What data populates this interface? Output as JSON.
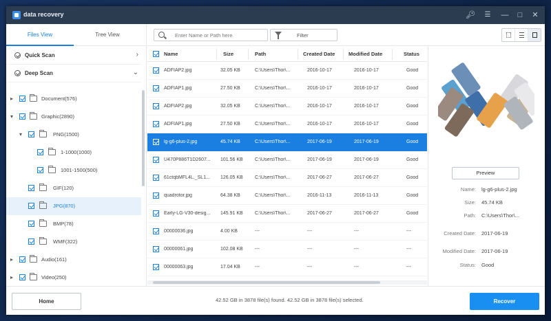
{
  "window": {
    "title": "data recovery"
  },
  "sidebar": {
    "tabs": [
      {
        "label": "Files View"
      },
      {
        "label": "Tree View"
      }
    ],
    "scans": [
      {
        "label": "Quick Scan"
      },
      {
        "label": "Deep Scan"
      }
    ],
    "tree": [
      {
        "label": "Document(576)"
      },
      {
        "label": "Graphic(2890)"
      },
      {
        "label": "PNG(1500)"
      },
      {
        "label": "1-1000(1000)"
      },
      {
        "label": "1001-1500(500)"
      },
      {
        "label": "GIF(120)"
      },
      {
        "label": "JPG(870)"
      },
      {
        "label": "BMP(78)"
      },
      {
        "label": "WMF(322)"
      },
      {
        "label": "Audio(161)"
      },
      {
        "label": "Video(250)"
      }
    ]
  },
  "toolbar": {
    "search_placeholder": "Enter Name or Path here",
    "filter_label": "Filter"
  },
  "table": {
    "columns": [
      "Name",
      "Size",
      "Path",
      "Created Date",
      "Modified Date",
      "Status"
    ],
    "rows": [
      {
        "name": "ADFIAP2.jpg",
        "size": "32.05 KB",
        "path": "C:\\Users\\Thor\\...",
        "created": "2016-10-17",
        "modified": "2016-10-17",
        "status": "Good"
      },
      {
        "name": "ADFIAP1.jpg",
        "size": "27.50 KB",
        "path": "C:\\Users\\Thor\\...",
        "created": "2016-10-17",
        "modified": "2016-10-17",
        "status": "Good"
      },
      {
        "name": "ADFIAP2.jpg",
        "size": "32.05 KB",
        "path": "C:\\Users\\Thor\\...",
        "created": "2016-10-17",
        "modified": "2016-10-17",
        "status": "Good"
      },
      {
        "name": "ADFIAP1.jpg",
        "size": "27.50 KB",
        "path": "C:\\Users\\Thor\\...",
        "created": "2016-10-17",
        "modified": "2016-10-17",
        "status": "Good"
      },
      {
        "name": "lg-g6-plus-2.jpg",
        "size": "45.74 KB",
        "path": "C:\\Users\\Thor\\...",
        "created": "2017-06-19",
        "modified": "2017-06-19",
        "status": "Good"
      },
      {
        "name": "U470P886T1D2607...",
        "size": "101.56 KB",
        "path": "C:\\Users\\Thor\\...",
        "created": "2017-06-19",
        "modified": "2017-06-19",
        "status": "Good"
      },
      {
        "name": "61ctqbMFL4L._SL1...",
        "size": "126.05 KB",
        "path": "C:\\Users\\Thor\\...",
        "created": "2017-06-27",
        "modified": "2017-06-27",
        "status": "Good"
      },
      {
        "name": "quadrotor.jpg",
        "size": "64.38 KB",
        "path": "C:\\Users\\Thor\\...",
        "created": "2016-11-13",
        "modified": "2016-11-13",
        "status": "Good"
      },
      {
        "name": "Early-LG-V30-desig...",
        "size": "145.91 KB",
        "path": "C:\\Users\\Thor\\...",
        "created": "2017-06-27",
        "modified": "2017-06-27",
        "status": "Good"
      },
      {
        "name": "00000036.jpg",
        "size": "4.00 KB",
        "path": "---",
        "created": "---",
        "modified": "---",
        "status": "---"
      },
      {
        "name": "00000061.jpg",
        "size": "102.08 KB",
        "path": "---",
        "created": "---",
        "modified": "---",
        "status": "---"
      },
      {
        "name": "00000063.jpg",
        "size": "17.04 KB",
        "path": "---",
        "created": "---",
        "modified": "---",
        "status": "---"
      }
    ]
  },
  "preview": {
    "button_label": "Preview",
    "labels": {
      "name": "Name:",
      "size": "Size:",
      "path": "Path:",
      "created": "Created Date:",
      "modified": "Modified Date:",
      "status": "Status:"
    },
    "values": {
      "name": "lg-g6-plus-2.jpg",
      "size": "45.74 KB",
      "path": "C:\\Users\\Thor\\...",
      "created": "2017-06-19",
      "modified": "2017-06-19",
      "status": "Good"
    }
  },
  "footer": {
    "home_label": "Home",
    "status": "42.52 GB in 3878 file(s) found.   42.52 GB in 3878 file(s) selected.",
    "recover_label": "Recover"
  },
  "colors": {
    "accent": "#1a7fe0",
    "titlebar": "#2b3b50",
    "recover": "#1a8ff2"
  }
}
